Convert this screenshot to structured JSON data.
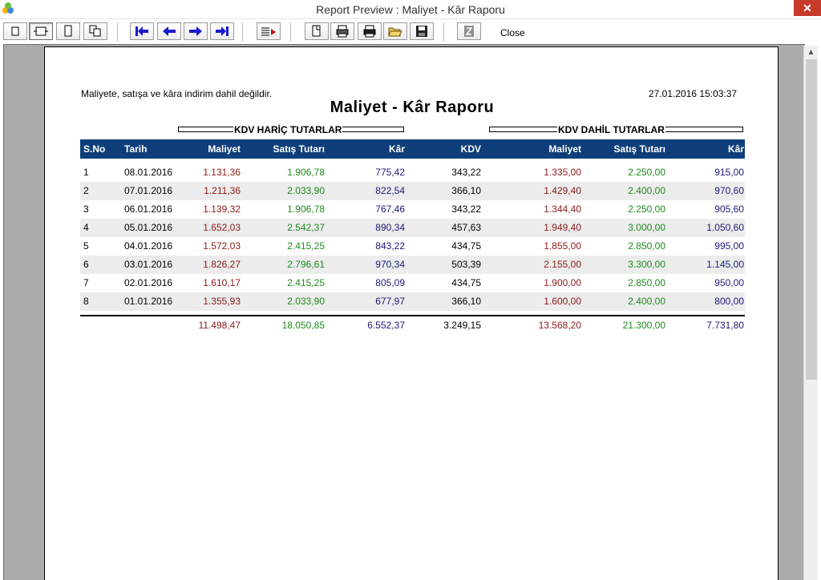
{
  "window": {
    "title": "Report Preview : Maliyet - Kâr Raporu",
    "close_glyph": "✕"
  },
  "toolbar": {
    "close_label": "Close",
    "buttons": [
      {
        "name": "single-page-view-button",
        "icon": "page-icon"
      },
      {
        "name": "page-width-view-button",
        "icon": "page-width-icon"
      },
      {
        "name": "full-page-view-button",
        "icon": "full-page-icon"
      },
      {
        "name": "multi-page-view-button",
        "icon": "multi-page-icon"
      },
      {
        "name": "first-page-button",
        "icon": "first-page-arrow-icon"
      },
      {
        "name": "previous-page-button",
        "icon": "left-arrow-icon"
      },
      {
        "name": "next-page-button",
        "icon": "right-arrow-icon"
      },
      {
        "name": "last-page-button",
        "icon": "last-page-arrow-icon"
      },
      {
        "name": "go-to-page-button",
        "icon": "go-to-page-icon"
      },
      {
        "name": "page-setup-button",
        "icon": "page-setup-icon"
      },
      {
        "name": "printer-setup-button",
        "icon": "printer-setup-icon"
      },
      {
        "name": "print-button",
        "icon": "printer-icon"
      },
      {
        "name": "open-file-button",
        "icon": "folder-open-icon"
      },
      {
        "name": "save-button",
        "icon": "floppy-disk-icon"
      },
      {
        "name": "export-button",
        "icon": "export-icon"
      }
    ]
  },
  "colors": {
    "header_bg": "#0f3f7a",
    "cost": "#8b1a1a",
    "sales": "#1f8a1f",
    "profit": "#1a1a7a",
    "alt_row": "#ececec"
  },
  "report": {
    "note": "Maliyete, satışa ve kâra indirim dahil değildir.",
    "datetime": "27.01.2016 15:03:37",
    "title": "Maliyet - Kâr Raporu",
    "group_excl": "KDV HARİÇ TUTARLAR",
    "group_incl": "KDV DAHİL TUTARLAR",
    "columns": [
      "S.No",
      "Tarih",
      "Maliyet",
      "Satış Tutarı",
      "Kâr",
      "KDV",
      "Maliyet",
      "Satış Tutarı",
      "Kâr"
    ],
    "rows": [
      [
        "1",
        "08.01.2016",
        "1.131,36",
        "1.906,78",
        "775,42",
        "343,22",
        "1.335,00",
        "2.250,00",
        "915,00"
      ],
      [
        "2",
        "07.01.2016",
        "1.211,36",
        "2.033,90",
        "822,54",
        "366,10",
        "1.429,40",
        "2.400,00",
        "970,60"
      ],
      [
        "3",
        "06.01.2016",
        "1.139,32",
        "1.906,78",
        "767,46",
        "343,22",
        "1.344,40",
        "2.250,00",
        "905,60"
      ],
      [
        "4",
        "05.01.2016",
        "1.652,03",
        "2.542,37",
        "890,34",
        "457,63",
        "1.949,40",
        "3.000,00",
        "1.050,60"
      ],
      [
        "5",
        "04.01.2016",
        "1.572,03",
        "2.415,25",
        "843,22",
        "434,75",
        "1.855,00",
        "2.850,00",
        "995,00"
      ],
      [
        "6",
        "03.01.2016",
        "1.826,27",
        "2.796,61",
        "970,34",
        "503,39",
        "2.155,00",
        "3.300,00",
        "1.145,00"
      ],
      [
        "7",
        "02.01.2016",
        "1.610,17",
        "2.415,25",
        "805,09",
        "434,75",
        "1.900,00",
        "2.850,00",
        "950,00"
      ],
      [
        "8",
        "01.01.2016",
        "1.355,93",
        "2.033,90",
        "677,97",
        "366,10",
        "1.600,00",
        "2.400,00",
        "800,00"
      ]
    ],
    "totals": [
      "11.498,47",
      "18.050,85",
      "6.552,37",
      "3.249,15",
      "13.568,20",
      "21.300,00",
      "7.731,80"
    ]
  }
}
